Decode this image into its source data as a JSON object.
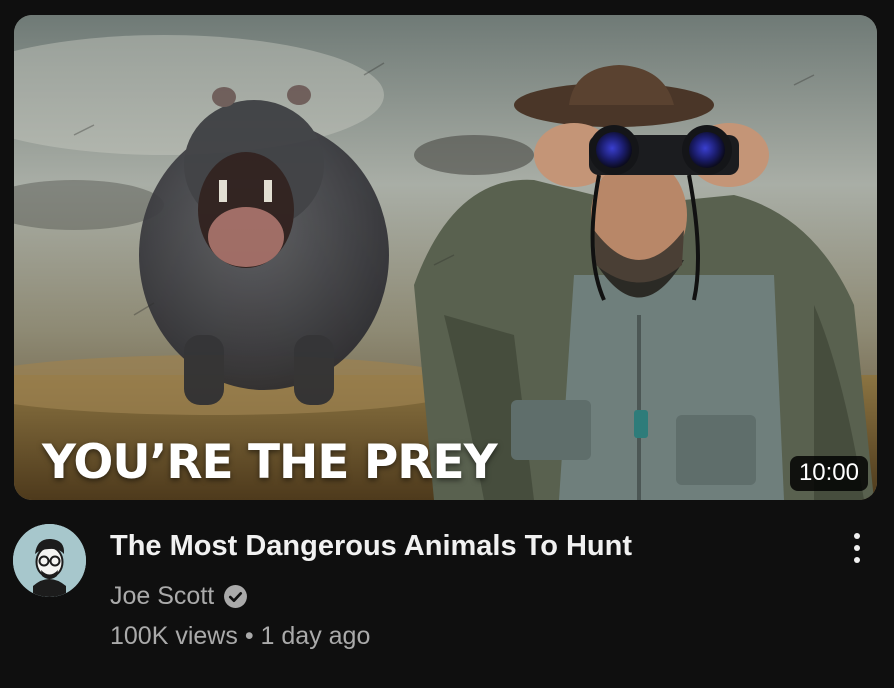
{
  "video": {
    "thumbnail_overlay_text": "YOU’RE THE PREY",
    "duration": "10:00",
    "title": "The Most Dangerous Animals To Hunt",
    "channel": "Joe Scott",
    "views": "100K views",
    "separator": "•",
    "age": "1 day ago"
  },
  "icons": {
    "verified": "verified-check-icon",
    "menu": "more-vertical-icon",
    "avatar": "channel-avatar-illustration"
  },
  "colors": {
    "background": "#0f0f0f",
    "title": "#f1f1f1",
    "secondary_text": "#aaaaaa",
    "duration_badge": "#000000",
    "avatar_bg": "#a7c7cc"
  }
}
